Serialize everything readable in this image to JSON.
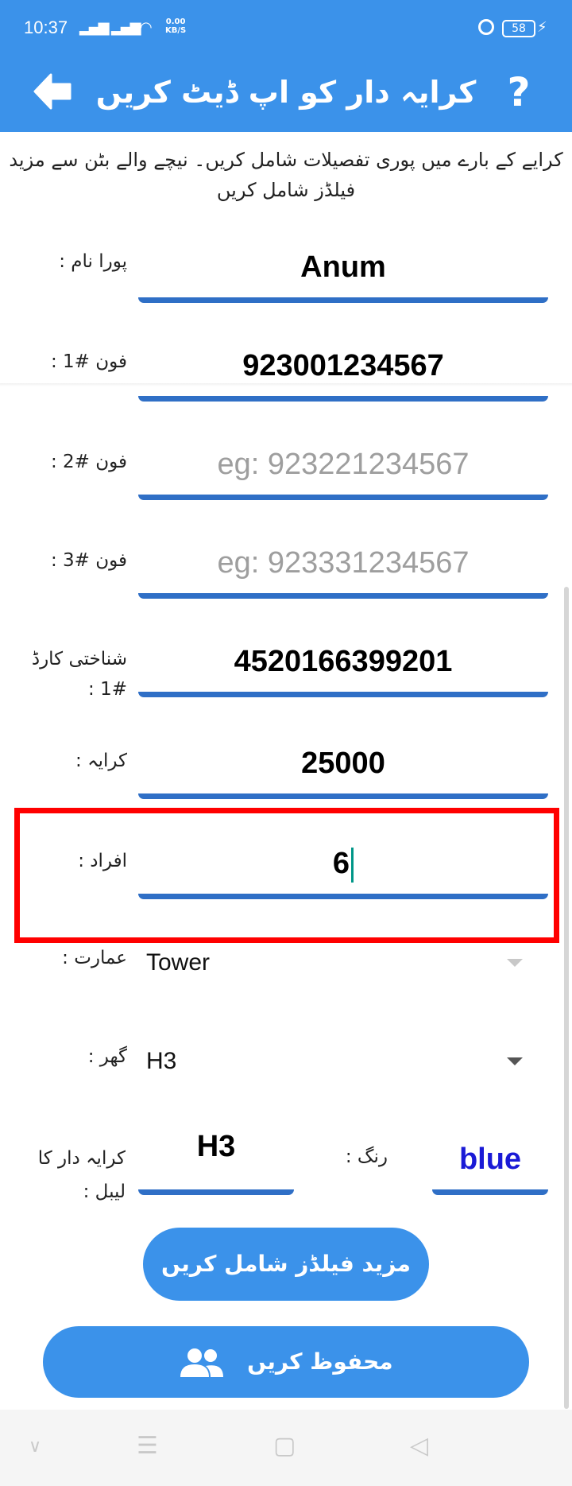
{
  "status_bar": {
    "time": "10:37",
    "speed_value": "0.00",
    "speed_unit": "KB/S",
    "battery": "58"
  },
  "app_bar": {
    "title": "کرایہ دار کو اپ ڈیٹ کریں",
    "help_glyph": "?"
  },
  "intro_text": "کرایے کے بارے میں پوری تفصیلات شامل کریں۔ نیچے والے بٹن سے مزید فیلڈز شامل کریں",
  "form": {
    "full_name": {
      "label": "پورا نام :",
      "value": "Anum"
    },
    "phone1": {
      "label": "فون #1 :",
      "value": "923001234567"
    },
    "phone2": {
      "label": "فون #2 :",
      "placeholder": "eg: 923221234567"
    },
    "phone3": {
      "label": "فون #3 :",
      "placeholder": "eg: 923331234567"
    },
    "id_card": {
      "label": "شناختی کارڈ #1 :",
      "value": "4520166399201"
    },
    "rent": {
      "label": "کرایہ :",
      "value": "25000"
    },
    "persons": {
      "label": "افراد :",
      "value": "6"
    },
    "building": {
      "label": "عمارت :",
      "selected": "Tower"
    },
    "house": {
      "label": "گھر :",
      "selected": "H3"
    },
    "tenant_label": {
      "label": "کرایہ دار کا لیبل :",
      "value": "H3"
    },
    "color": {
      "label": "رنگ :",
      "value": "blue",
      "value_color": "#1a1ad6"
    }
  },
  "buttons": {
    "add_fields": "مزید فیلڈز شامل کریں",
    "save": "محفوظ کریں"
  },
  "colors": {
    "primary": "#3b92ea",
    "underline": "#2f6fc6",
    "highlight": "#ff0000"
  }
}
